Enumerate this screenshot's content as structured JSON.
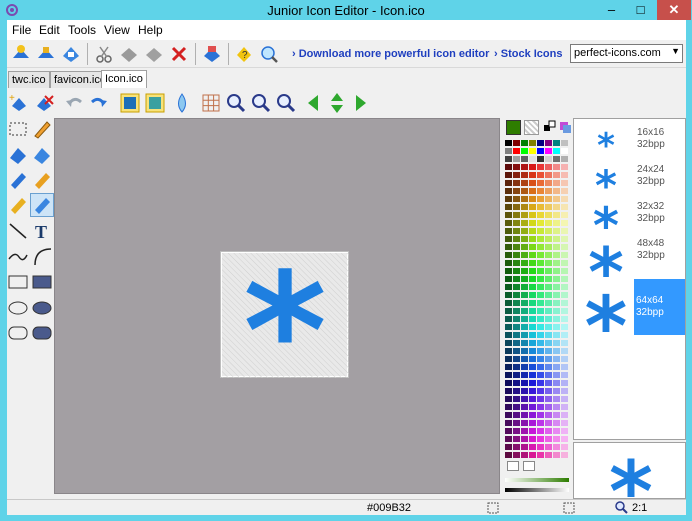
{
  "window": {
    "title": "Junior Icon Editor - Icon.ico",
    "min": "–",
    "max": "□",
    "close": "✕"
  },
  "menu": [
    "File",
    "Edit",
    "Tools",
    "View",
    "Help"
  ],
  "toolbar": {
    "links": [
      "Download more powerful icon editor",
      "Stock Icons"
    ],
    "site_select": "perfect-icons.com",
    "arrow": "›"
  },
  "tabs": [
    "twc.ico",
    "favicon.ico",
    "Icon.ico"
  ],
  "sizes": [
    {
      "size": "16x16",
      "depth": "32bpp"
    },
    {
      "size": "24x24",
      "depth": "32bpp"
    },
    {
      "size": "32x32",
      "depth": "32bpp"
    },
    {
      "size": "48x48",
      "depth": "32bpp"
    },
    {
      "size": "64x64",
      "depth": "32bpp"
    }
  ],
  "selected_size_index": 4,
  "status": {
    "color": "#009B32",
    "zoom": "2:1"
  },
  "colors": {
    "accent": "#1e7fe0",
    "selected": "#3399ff",
    "canvas": "#a39fa3",
    "foreground": "#2e7d00"
  },
  "icon_glyph": "*",
  "tool_glyphs": {
    "text": "T"
  }
}
